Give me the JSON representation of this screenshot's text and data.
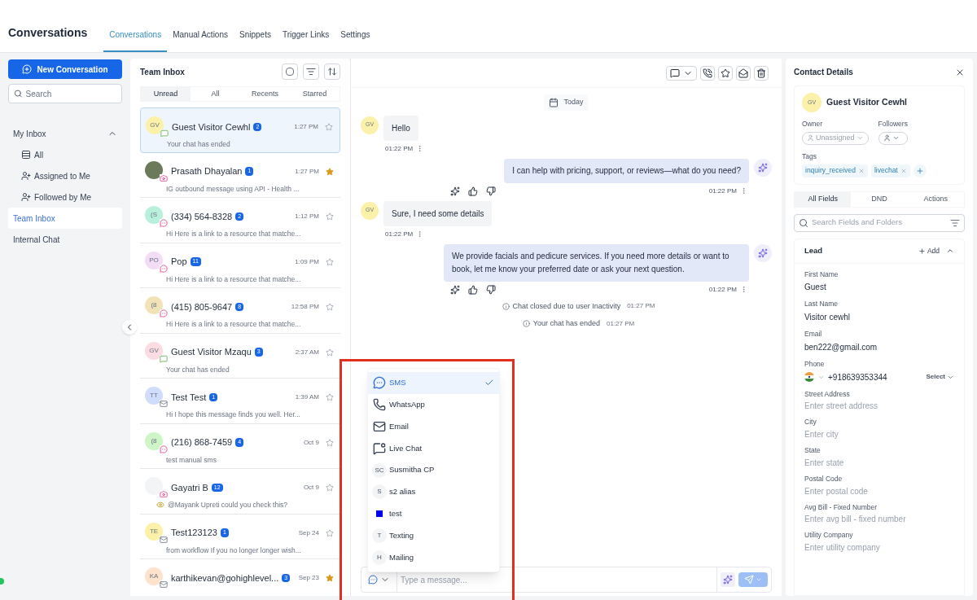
{
  "header": {
    "title": "Conversations",
    "tabs": [
      {
        "label": "Conversations",
        "selected": true
      },
      {
        "label": "Manual Actions",
        "selected": false
      },
      {
        "label": "Snippets",
        "selected": false
      },
      {
        "label": "Trigger Links",
        "selected": false
      },
      {
        "label": "Settings",
        "selected": false
      }
    ]
  },
  "sidebar": {
    "new_button": "New Conversation",
    "search": {
      "placeholder": "Search"
    },
    "nav": [
      {
        "label": "My Inbox",
        "expanded": true,
        "selected": false,
        "children": [
          {
            "label": "All",
            "kind": "list",
            "selected": false
          },
          {
            "label": "Assigned to Me",
            "kind": "user",
            "selected": false
          },
          {
            "label": "Followed by Me",
            "kind": "user",
            "selected": false
          }
        ]
      },
      {
        "label": "Team Inbox",
        "selected": true
      },
      {
        "label": "Internal Chat",
        "selected": false
      }
    ]
  },
  "inbox": {
    "title": "Team Inbox",
    "select_all": {
      "checked": false
    },
    "filters": [
      {
        "label": "Unread",
        "selected": true
      },
      {
        "label": "All",
        "selected": false
      },
      {
        "label": "Recents",
        "selected": false
      },
      {
        "label": "Starred",
        "selected": false
      }
    ],
    "conversations": [
      {
        "avatar": {
          "kind": "initials",
          "initials": "GV",
          "color": "#fbf1a9"
        },
        "channel": {
          "kind": "livechat"
        },
        "name": "Guest Visitor Cewhl",
        "badge": "2",
        "time": "1:27 PM",
        "preview": "Your chat has ended",
        "note": false,
        "starred": false,
        "selected": true
      },
      {
        "avatar": {
          "kind": "photo",
          "color": "#6b7a5a"
        },
        "channel": {
          "kind": "instagram"
        },
        "name": "Prasath Dhayalan",
        "badge": "1",
        "time": "1:27 PM",
        "preview": "IG outbound message using API - Health ...",
        "note": false,
        "starred": true,
        "selected": false
      },
      {
        "avatar": {
          "kind": "initials",
          "initials": "(S",
          "color": "#b9f0dc"
        },
        "channel": {
          "kind": "sms"
        },
        "name": "(334) 564-8328",
        "badge": "2",
        "time": "1:12 PM",
        "preview": "Hi Here is a link to a resource that matche...",
        "note": false,
        "starred": false,
        "selected": false
      },
      {
        "avatar": {
          "kind": "initials",
          "initials": "PO",
          "color": "#f3dcf5"
        },
        "channel": {
          "kind": "sms"
        },
        "name": "Pop",
        "badge": "11",
        "time": "1:09 PM",
        "preview": "Hi Here is a link to a resource that matche...",
        "note": false,
        "starred": false,
        "selected": false
      },
      {
        "avatar": {
          "kind": "initials",
          "initials": "(8",
          "color": "#f2e2b8"
        },
        "channel": {
          "kind": "sms"
        },
        "name": "(415) 805-9647",
        "badge": "8",
        "time": "12:58 PM",
        "preview": "Hi Here is a link to a resource that matche...",
        "note": false,
        "starred": false,
        "selected": false
      },
      {
        "avatar": {
          "kind": "initials",
          "initials": "GV",
          "color": "#fadde3"
        },
        "channel": {
          "kind": "livechat"
        },
        "name": "Guest Visitor Mzaqu",
        "badge": "3",
        "time": "2:37 AM",
        "preview": "Your chat has ended",
        "note": false,
        "starred": false,
        "selected": false
      },
      {
        "avatar": {
          "kind": "initials",
          "initials": "TT",
          "color": "#cfdcfb"
        },
        "channel": {
          "kind": "email"
        },
        "name": "Test Test",
        "badge": "1",
        "time": "1:39 AM",
        "preview": "Hi I hope this message finds you well. Her...",
        "note": false,
        "starred": false,
        "selected": false
      },
      {
        "avatar": {
          "kind": "initials",
          "initials": "(8",
          "color": "#cdf5c8"
        },
        "channel": {
          "kind": "sms"
        },
        "name": "(216) 868-7459",
        "badge": "4",
        "time": "Oct 9",
        "preview": "test manual sms",
        "note": false,
        "starred": false,
        "selected": false
      },
      {
        "avatar": {
          "kind": "blank",
          "color": "#f3f4f6"
        },
        "channel": {
          "kind": "instagram"
        },
        "name": "Gayatri B",
        "badge": "12",
        "time": "Oct 9",
        "preview": "@Mayank Upreti could you check this?",
        "note": true,
        "starred": false,
        "selected": false
      },
      {
        "avatar": {
          "kind": "initials",
          "initials": "TE",
          "color": "#fbf1a9"
        },
        "channel": {
          "kind": "email"
        },
        "name": "Test123123",
        "badge": "1",
        "time": "Sep 24",
        "preview": "from workflow If you no longer longer wish...",
        "note": false,
        "starred": false,
        "selected": false
      },
      {
        "avatar": {
          "kind": "initials",
          "initials": "KA",
          "color": "#fde2cc"
        },
        "channel": {
          "kind": "email"
        },
        "name": "karthikevan@gohighlevel...",
        "badge": "3",
        "time": "Sep 23",
        "note": false,
        "starred": true,
        "selected": false
      }
    ]
  },
  "chat": {
    "date": "Today",
    "messages": [
      {
        "kind": "incoming",
        "initials": "GV",
        "text": "Hello",
        "time": "01:22 PM"
      },
      {
        "kind": "outgoing",
        "text": "I can help with pricing, support, or reviews—what do you need?",
        "time": "01:22 PM"
      },
      {
        "kind": "incoming",
        "initials": "GV",
        "text": "Sure, I need some details",
        "time": "01:22 PM"
      },
      {
        "kind": "outgoing",
        "text": "We provide facials and pedicure services. If you need more details or want to book, let me know your preferred date or ask your next question.",
        "time": "01:22 PM"
      },
      {
        "kind": "event",
        "text": "Chat closed due to user Inactivity",
        "time": "01:27 PM"
      },
      {
        "kind": "event",
        "text": "Your chat has ended",
        "time": "01:27 PM"
      }
    ],
    "channel_menu": [
      {
        "kind": "sms",
        "label": "SMS",
        "selected": true
      },
      {
        "kind": "whatsapp",
        "label": "WhatsApp",
        "selected": false
      },
      {
        "kind": "email",
        "label": "Email",
        "selected": false
      },
      {
        "kind": "livechat",
        "label": "Live Chat",
        "selected": false
      },
      {
        "kind": "initials",
        "initials": "SC",
        "label": "Susmitha CP",
        "selected": false
      },
      {
        "kind": "initials",
        "initials": "S",
        "label": "s2 alias",
        "selected": false
      },
      {
        "kind": "square",
        "color": "#0000ee",
        "label": "test",
        "selected": false
      },
      {
        "kind": "initials",
        "initials": "T",
        "label": "Texting",
        "selected": false
      },
      {
        "kind": "initials",
        "initials": "H",
        "label": "Mailing",
        "selected": false
      }
    ],
    "composer": {
      "placeholder": "Type a message..."
    }
  },
  "contact": {
    "title": "Contact Details",
    "initials": "GV",
    "name": "Guest Visitor Cewhl",
    "owner_label": "Owner",
    "owner": "Unassigned",
    "followers_label": "Followers",
    "tags_label": "Tags",
    "tags": [
      "inquiry_received",
      "livechat"
    ],
    "tabs": [
      {
        "label": "All Fields",
        "selected": true
      },
      {
        "label": "DND",
        "selected": false
      },
      {
        "label": "Actions",
        "selected": false
      }
    ],
    "search": {
      "placeholder": "Search Fields and Folders"
    },
    "section": {
      "title": "Lead",
      "add": "Add",
      "expanded": true,
      "fields": [
        {
          "kind": "text",
          "label": "First Name",
          "value": "Guest"
        },
        {
          "kind": "text",
          "label": "Last Name",
          "value": "Visitor cewhl"
        },
        {
          "kind": "text",
          "label": "Email",
          "value": "ben222@gmail.com"
        },
        {
          "kind": "phone",
          "label": "Phone",
          "value": "+918639353344",
          "select": "Select"
        },
        {
          "kind": "text",
          "label": "Street Address",
          "placeholder": "Enter street address"
        },
        {
          "kind": "text",
          "label": "City",
          "placeholder": "Enter city"
        },
        {
          "kind": "text",
          "label": "State",
          "placeholder": "Enter state"
        },
        {
          "kind": "text",
          "label": "Postal Code",
          "placeholder": "Enter postal code"
        },
        {
          "kind": "text",
          "label": "Avg Bill - Fixed Number",
          "placeholder": "Enter avg bill - fixed number"
        },
        {
          "kind": "text",
          "label": "Utility Company",
          "placeholder": "Enter utility company"
        }
      ]
    }
  }
}
